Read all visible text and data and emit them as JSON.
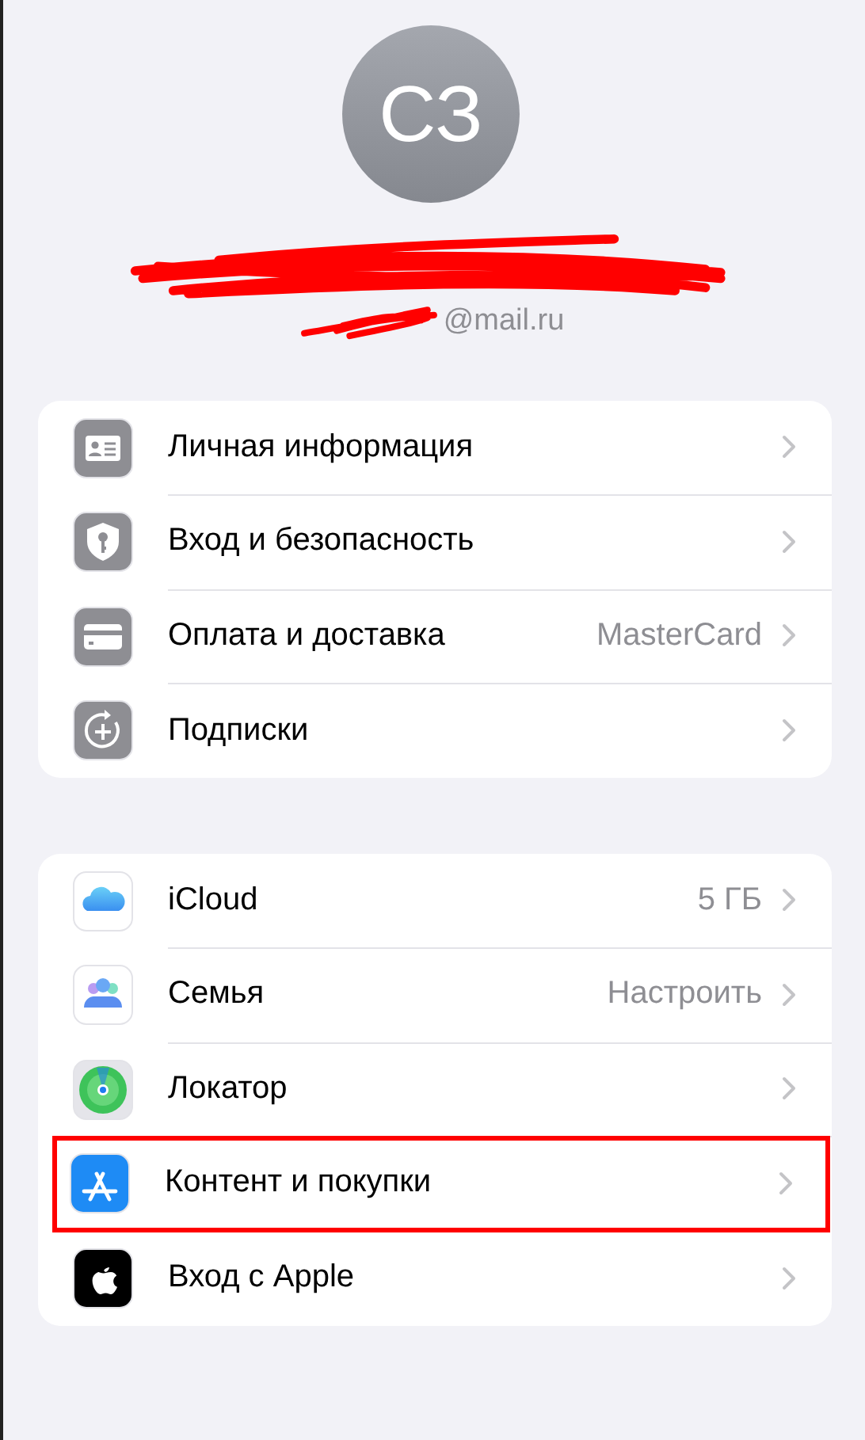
{
  "profile": {
    "initials": "СЗ",
    "email": "@mail.ru",
    "name_redacted": true
  },
  "groups": [
    {
      "rows": [
        {
          "label": "Личная информация",
          "highlighted": false
        },
        {
          "label": "Вход и безопасность",
          "highlighted": false
        },
        {
          "label": "Оплата и доставка",
          "detail": "MasterCard",
          "highlighted": false
        },
        {
          "label": "Подписки",
          "highlighted": false
        }
      ]
    },
    {
      "rows": [
        {
          "label": "iCloud",
          "detail": "5 ГБ",
          "highlighted": false
        },
        {
          "label": "Семья",
          "detail": "Настроить",
          "highlighted": false
        },
        {
          "label": "Локатор",
          "highlighted": false
        },
        {
          "label": "Контент и покупки",
          "highlighted": true
        },
        {
          "label": "Вход с Apple",
          "highlighted": false
        }
      ]
    }
  ]
}
